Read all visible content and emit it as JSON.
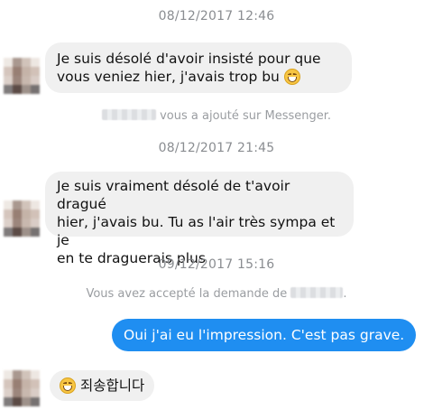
{
  "conversation": {
    "timestamps": [
      "08/12/2017 12:46",
      "08/12/2017 21:45",
      "09/12/2017 15:16"
    ],
    "messages": [
      {
        "direction": "incoming",
        "text": "Je suis désolé d'avoir insisté pour que\nvous veniez hier, j'avais trop bu",
        "emoji": "grinning-face-icon"
      },
      {
        "direction": "incoming",
        "text": "Je suis vraiment désolé de t'avoir dragué\nhier, j'avais bu. Tu as l'air très sympa et je\nen te draguerais plus"
      },
      {
        "direction": "outgoing",
        "text": "Oui j'ai eu l'impression. C'est pas grave."
      },
      {
        "direction": "incoming",
        "text": "죄송합니다",
        "emoji": "grinning-face-icon"
      }
    ],
    "notices": [
      {
        "prefix": "",
        "suffix": "vous a ajouté sur Messenger."
      },
      {
        "prefix": "Vous avez accepté la demande de",
        "suffix": "."
      }
    ]
  },
  "colors": {
    "incoming_bubble": "#f0f0f0",
    "outgoing_bubble": "#1f8ef1",
    "timestamp_text": "#8a8d91"
  }
}
